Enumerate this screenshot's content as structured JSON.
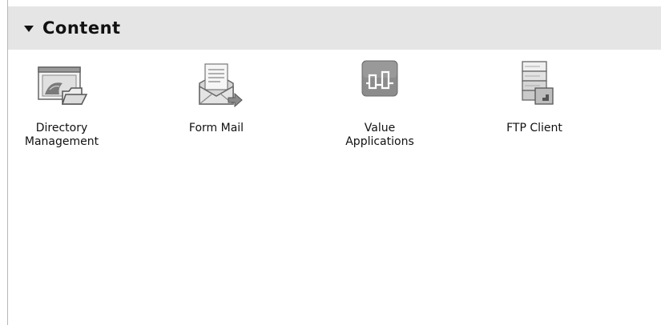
{
  "panel": {
    "title": "Content"
  },
  "tiles": [
    {
      "label": "Directory\nManagement",
      "icon": "directory-management-icon"
    },
    {
      "label": "Form Mail",
      "icon": "form-mail-icon"
    },
    {
      "label": "Value\nApplications",
      "icon": "value-applications-icon"
    },
    {
      "label": "FTP Client",
      "icon": "ftp-client-icon"
    }
  ],
  "colors": {
    "header_bg": "#e6e5e5",
    "selected_icon_bg": "#8c8c8c"
  }
}
